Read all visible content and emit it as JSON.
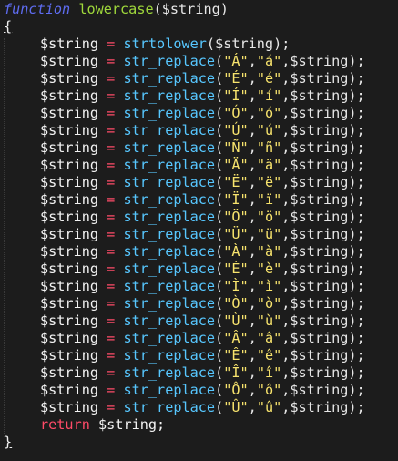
{
  "code": {
    "keyword_function": "function",
    "function_name": "lowercase",
    "param_open": "($string)",
    "brace_open": "{",
    "brace_close": "}",
    "first_stmt": {
      "var": "$string",
      "op": "=",
      "func": "strtolower",
      "args": "($string);"
    },
    "replace_stmts": [
      {
        "from": "Á",
        "to": "á"
      },
      {
        "from": "É",
        "to": "é"
      },
      {
        "from": "Í",
        "to": "í"
      },
      {
        "from": "Ó",
        "to": "ó"
      },
      {
        "from": "Ú",
        "to": "ú"
      },
      {
        "from": "Ñ",
        "to": "ñ"
      },
      {
        "from": "Ä",
        "to": "ä"
      },
      {
        "from": "Ë",
        "to": "ë"
      },
      {
        "from": "Ï",
        "to": "ï"
      },
      {
        "from": "Ö",
        "to": "ö"
      },
      {
        "from": "Ü",
        "to": "ü"
      },
      {
        "from": "À",
        "to": "à"
      },
      {
        "from": "È",
        "to": "è"
      },
      {
        "from": "Ì",
        "to": "ì"
      },
      {
        "from": "Ò",
        "to": "ò"
      },
      {
        "from": "Ù",
        "to": "ù"
      },
      {
        "from": "Â",
        "to": "â"
      },
      {
        "from": "Ê",
        "to": "ê"
      },
      {
        "from": "Î",
        "to": "î"
      },
      {
        "from": "Ô",
        "to": "ô"
      },
      {
        "from": "Û",
        "to": "û"
      }
    ],
    "replace_var": "$string",
    "replace_op": "=",
    "replace_func": "str_replace",
    "replace_tail": ",$string);",
    "return_kw": "return",
    "return_value": "$string;"
  },
  "colors": {
    "background": "#1c1c1c",
    "keyword": "#5e6cf0",
    "function_name": "#9fd83b",
    "operator": "#ff4b68",
    "builtin": "#57c7ff",
    "string": "#f7e36d",
    "text": "#f2f2f2"
  }
}
